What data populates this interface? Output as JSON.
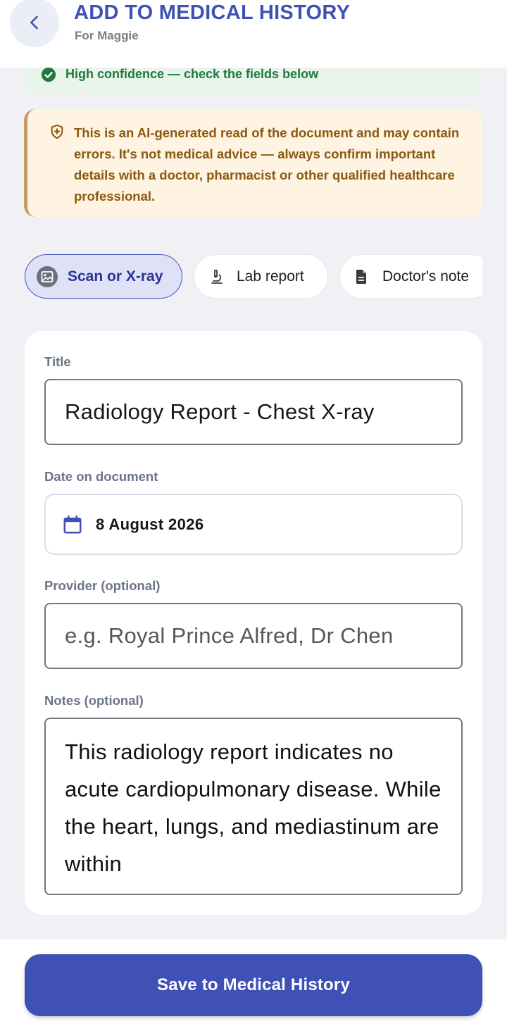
{
  "header": {
    "title": "ADD TO MEDICAL HISTORY",
    "subtitle": "For Maggie"
  },
  "confidence": {
    "text": "High confidence — check the fields below"
  },
  "disclaimer": {
    "text": "This is an AI-generated read of the document and may contain errors. It's not medical advice — always confirm important details with a doctor, pharmacist or other qualified healthcare professional."
  },
  "chips": [
    {
      "label": "Scan or X-ray",
      "icon": "scan-image-icon",
      "selected": true
    },
    {
      "label": "Lab report",
      "icon": "microscope-icon",
      "selected": false
    },
    {
      "label": "Doctor's note",
      "icon": "document-icon",
      "selected": false
    }
  ],
  "form": {
    "title_label": "Title",
    "title_value": "Radiology Report - Chest X-ray",
    "date_label": "Date on document",
    "date_value": "8 August 2026",
    "provider_label": "Provider (optional)",
    "provider_placeholder": "e.g. Royal Prince Alfred, Dr Chen",
    "notes_label": "Notes (optional)",
    "notes_value": "This radiology report indicates no acute cardiopulmonary disease. While the heart, lungs, and mediastinum are within"
  },
  "footer": {
    "save_label": "Save to Medical History"
  },
  "colors": {
    "primary": "#3f51b5",
    "success": "#1e7a3d",
    "warning_text": "#8a5a10",
    "warning_bg": "#fff3e2"
  }
}
